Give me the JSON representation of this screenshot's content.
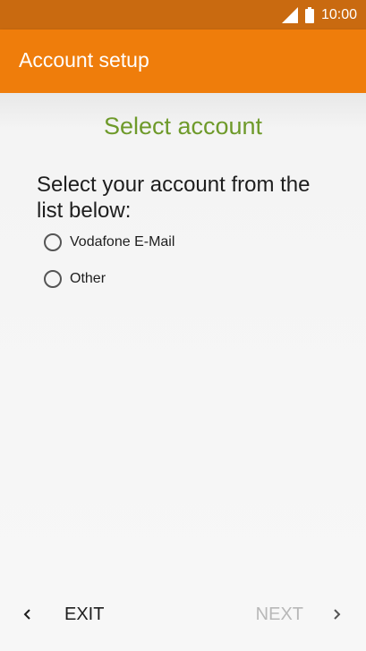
{
  "status_bar": {
    "time": "10:00",
    "icons": [
      "signal-icon",
      "battery-icon"
    ]
  },
  "app_bar": {
    "title": "Account setup"
  },
  "main": {
    "title": "Select account",
    "prompt": "Select your account from the list below:",
    "options": [
      {
        "label": "Vodafone E-Mail",
        "selected": false
      },
      {
        "label": "Other",
        "selected": false
      }
    ]
  },
  "footer": {
    "exit_label": "EXIT",
    "next_label": "NEXT",
    "next_enabled": false
  },
  "colors": {
    "status_bar": "#c96a10",
    "app_bar": "#ef7d0b",
    "title_green": "#6e9a2a",
    "disabled_text": "#b8b8b8"
  }
}
